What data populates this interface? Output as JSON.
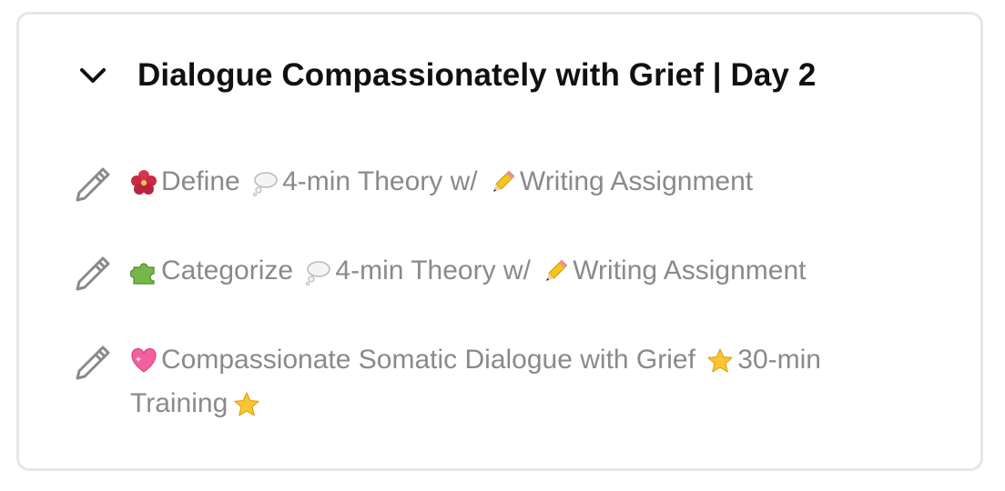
{
  "section": {
    "title": "Dialogue Compassionately with Grief | Day 2",
    "expand_icon": "chevron-down-icon"
  },
  "lessons": [
    {
      "icon": "pencil-icon",
      "leading_emoji": "hibiscus-icon",
      "part1": "Define",
      "separator_emoji": "thought-balloon-icon",
      "part2": "4-min Theory w/",
      "inline_emoji": "pencil-emoji-icon",
      "part3": "Writing Assignment"
    },
    {
      "icon": "pencil-icon",
      "leading_emoji": "puzzle-piece-icon",
      "part1": "Categorize",
      "separator_emoji": "thought-balloon-icon",
      "part2": "4-min Theory w/",
      "inline_emoji": "pencil-emoji-icon",
      "part3": "Writing Assignment"
    },
    {
      "icon": "pencil-icon",
      "leading_emoji": "sparkling-heart-icon",
      "part1": "Compassionate Somatic Dialogue with Grief",
      "separator_emoji": "star-icon",
      "part2": "30-min Training",
      "trailing_emoji": "star-icon"
    }
  ],
  "colors": {
    "title": "#111111",
    "lesson_text": "#8a8a8a",
    "card_border": "#e6e6e6"
  }
}
